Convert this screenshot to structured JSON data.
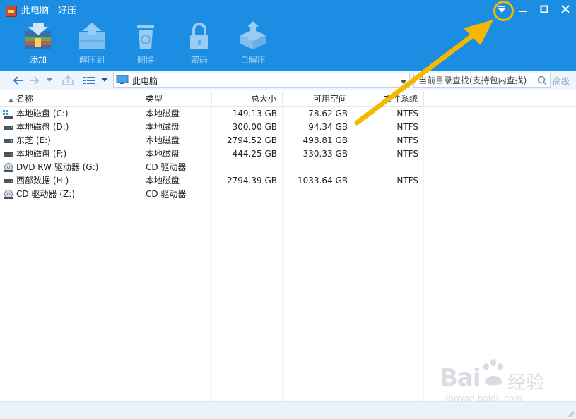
{
  "window": {
    "title": "此电脑 - 好压"
  },
  "toolbar": {
    "items": [
      {
        "label": "添加",
        "icon": "add-archive-icon",
        "enabled": true
      },
      {
        "label": "解压到",
        "icon": "extract-icon",
        "enabled": false
      },
      {
        "label": "删除",
        "icon": "recycle-bin-icon",
        "enabled": false
      },
      {
        "label": "密码",
        "icon": "lock-icon",
        "enabled": false
      },
      {
        "label": "自解压",
        "icon": "self-extract-icon",
        "enabled": false
      }
    ]
  },
  "nav": {
    "address_path": "此电脑",
    "search_placeholder": "当前目录查找(支持包内查找)",
    "advanced_label": "高级"
  },
  "list": {
    "columns": [
      "名称",
      "类型",
      "总大小",
      "可用空间",
      "文件系统"
    ],
    "rows": [
      {
        "name": "本地磁盘 (C:)",
        "type": "本地磁盘",
        "total": "149.13 GB",
        "free": "78.62 GB",
        "fs": "NTFS",
        "icon": "system-drive-icon"
      },
      {
        "name": "本地磁盘 (D:)",
        "type": "本地磁盘",
        "total": "300.00 GB",
        "free": "94.34 GB",
        "fs": "NTFS",
        "icon": "hard-drive-icon"
      },
      {
        "name": "东芝 (E:)",
        "type": "本地磁盘",
        "total": "2794.52 GB",
        "free": "498.81 GB",
        "fs": "NTFS",
        "icon": "hard-drive-icon"
      },
      {
        "name": "本地磁盘 (F:)",
        "type": "本地磁盘",
        "total": "444.25 GB",
        "free": "330.33 GB",
        "fs": "NTFS",
        "icon": "hard-drive-icon"
      },
      {
        "name": "DVD RW 驱动器 (G:)",
        "type": "CD 驱动器",
        "total": "",
        "free": "",
        "fs": "",
        "icon": "optical-drive-icon"
      },
      {
        "name": "西部数据 (H:)",
        "type": "本地磁盘",
        "total": "2794.39 GB",
        "free": "1033.64 GB",
        "fs": "NTFS",
        "icon": "hard-drive-icon"
      },
      {
        "name": "CD 驱动器 (Z:)",
        "type": "CD 驱动器",
        "total": "",
        "free": "",
        "fs": "",
        "icon": "optical-drive-icon"
      }
    ]
  },
  "watermark": {
    "brand_latin": "Bai",
    "brand_cn": "经验",
    "url": "jingyan.baidu.com"
  },
  "colors": {
    "titlebar": "#1b8ee3",
    "highlight": "#f5b800"
  }
}
